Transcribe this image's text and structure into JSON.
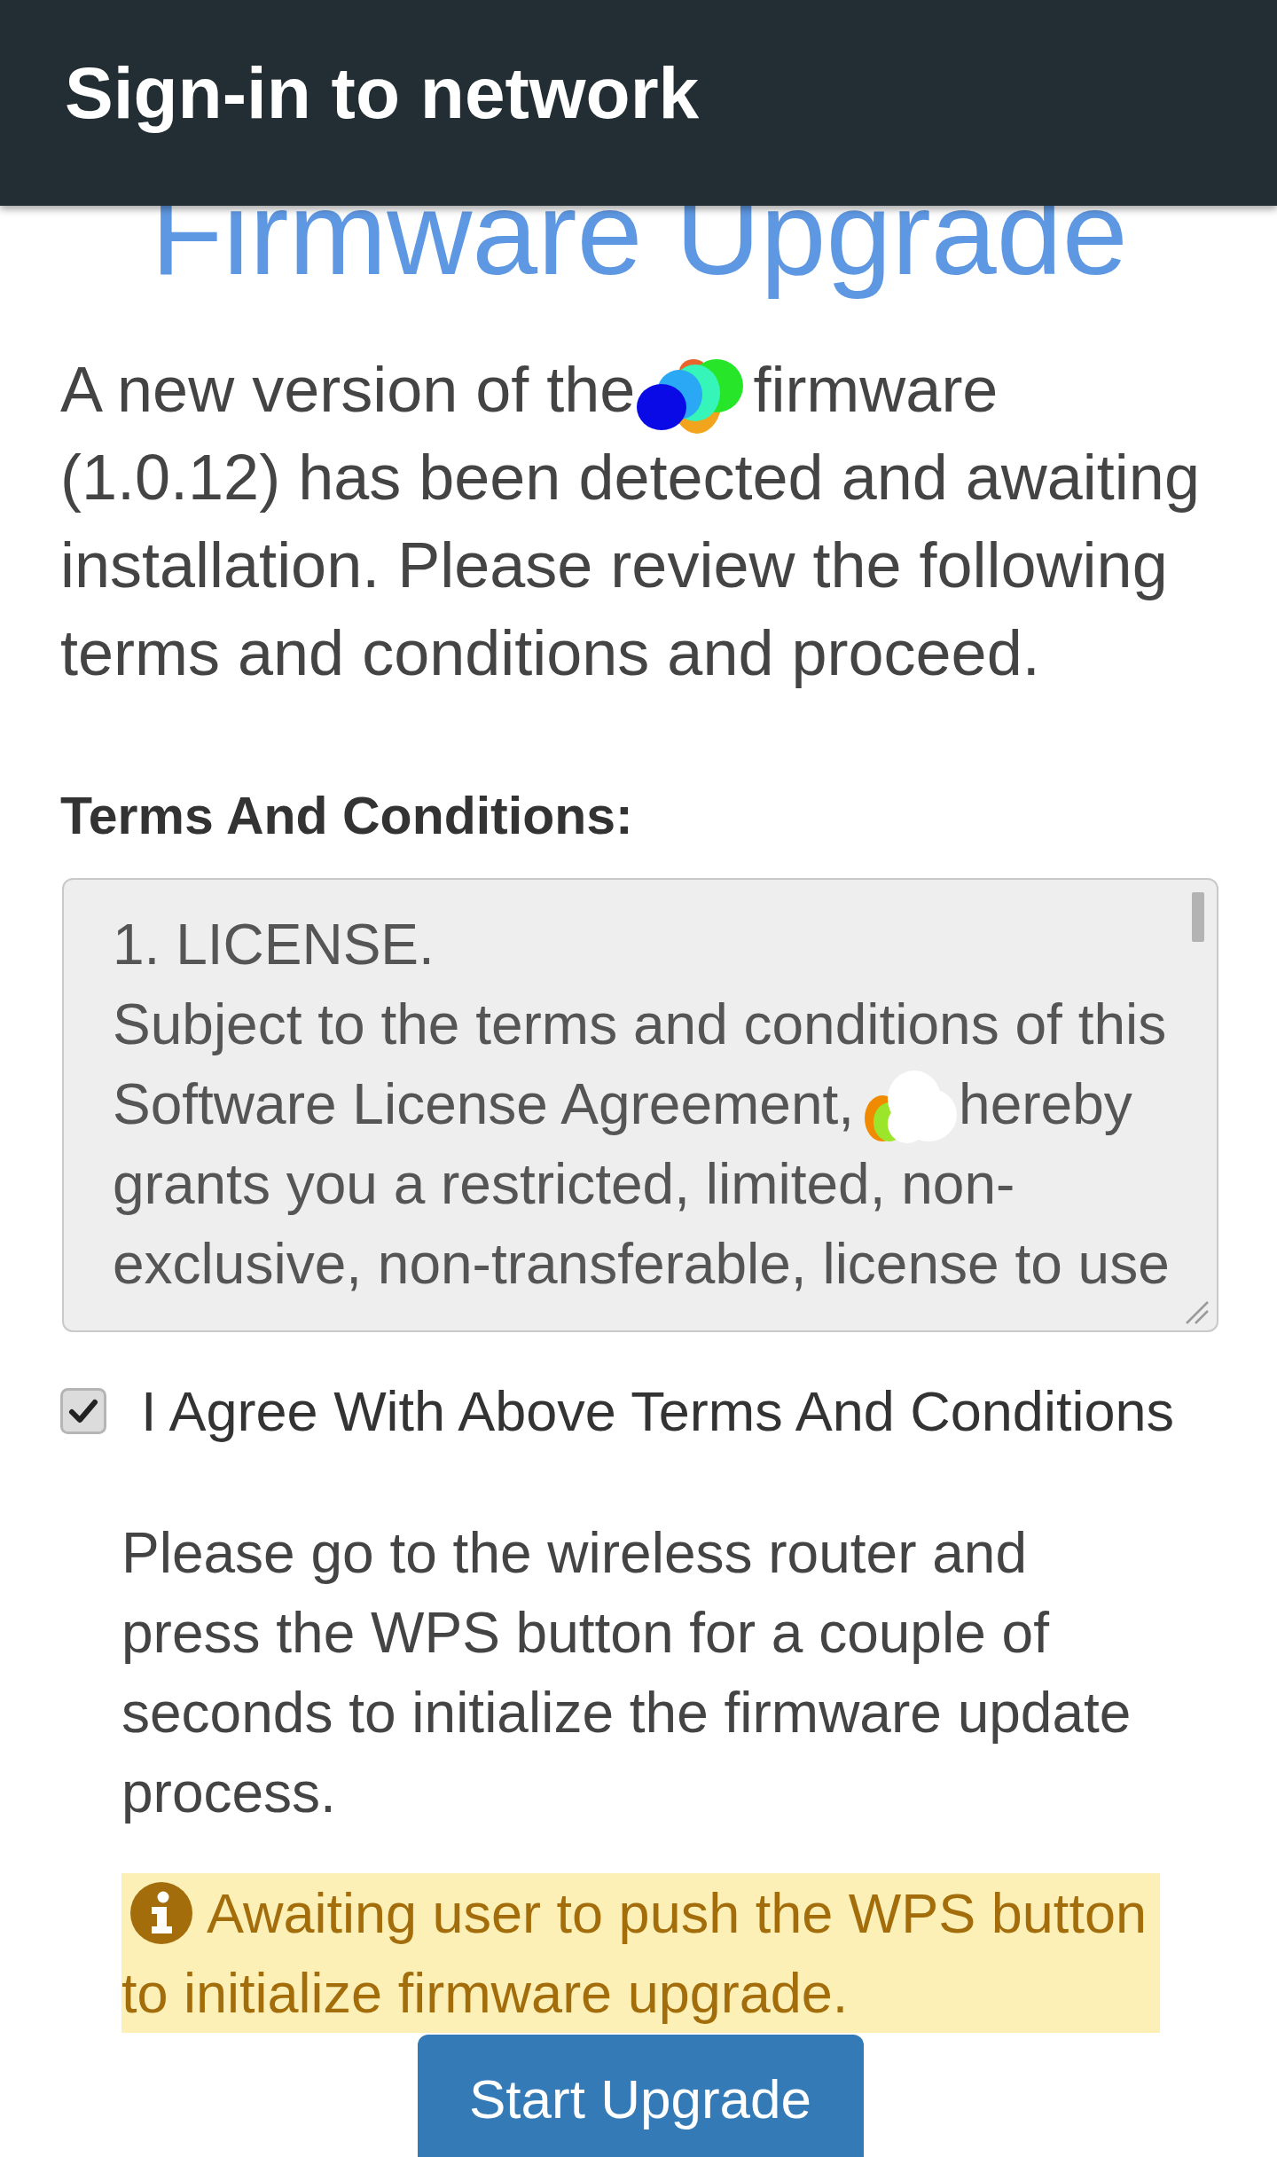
{
  "header": {
    "title": "Sign-in to network"
  },
  "page": {
    "heading": "Firmware Upgrade",
    "intro": {
      "before": "A new version of the",
      "after": "firmware",
      "rest": "(1.0.12) has been detected and awaiting installation. Please review the following terms and conditions and proceed."
    },
    "terms_label": "Terms And Conditions:",
    "terms_box": {
      "heading": "1. LICENSE.",
      "lead": "Subject to the terms and conditions of this",
      "before": "Software License Agreement,",
      "after": "hereby",
      "rest": "grants you a restricted, limited, non-exclusive, non-transferable, license to use"
    },
    "agree": {
      "label": "I Agree With Above Terms And Conditions",
      "checked": true
    },
    "instructions": "Please go to the wireless router and press the WPS button for a couple of seconds to initialize the firmware update process.",
    "alert": {
      "kind": "warning",
      "lines": [
        "Awaiting user to push the WPS button",
        "to initialize firmware upgrade."
      ]
    },
    "buttons": [
      {
        "label": "Start Upgrade",
        "kind": "primary"
      }
    ]
  }
}
